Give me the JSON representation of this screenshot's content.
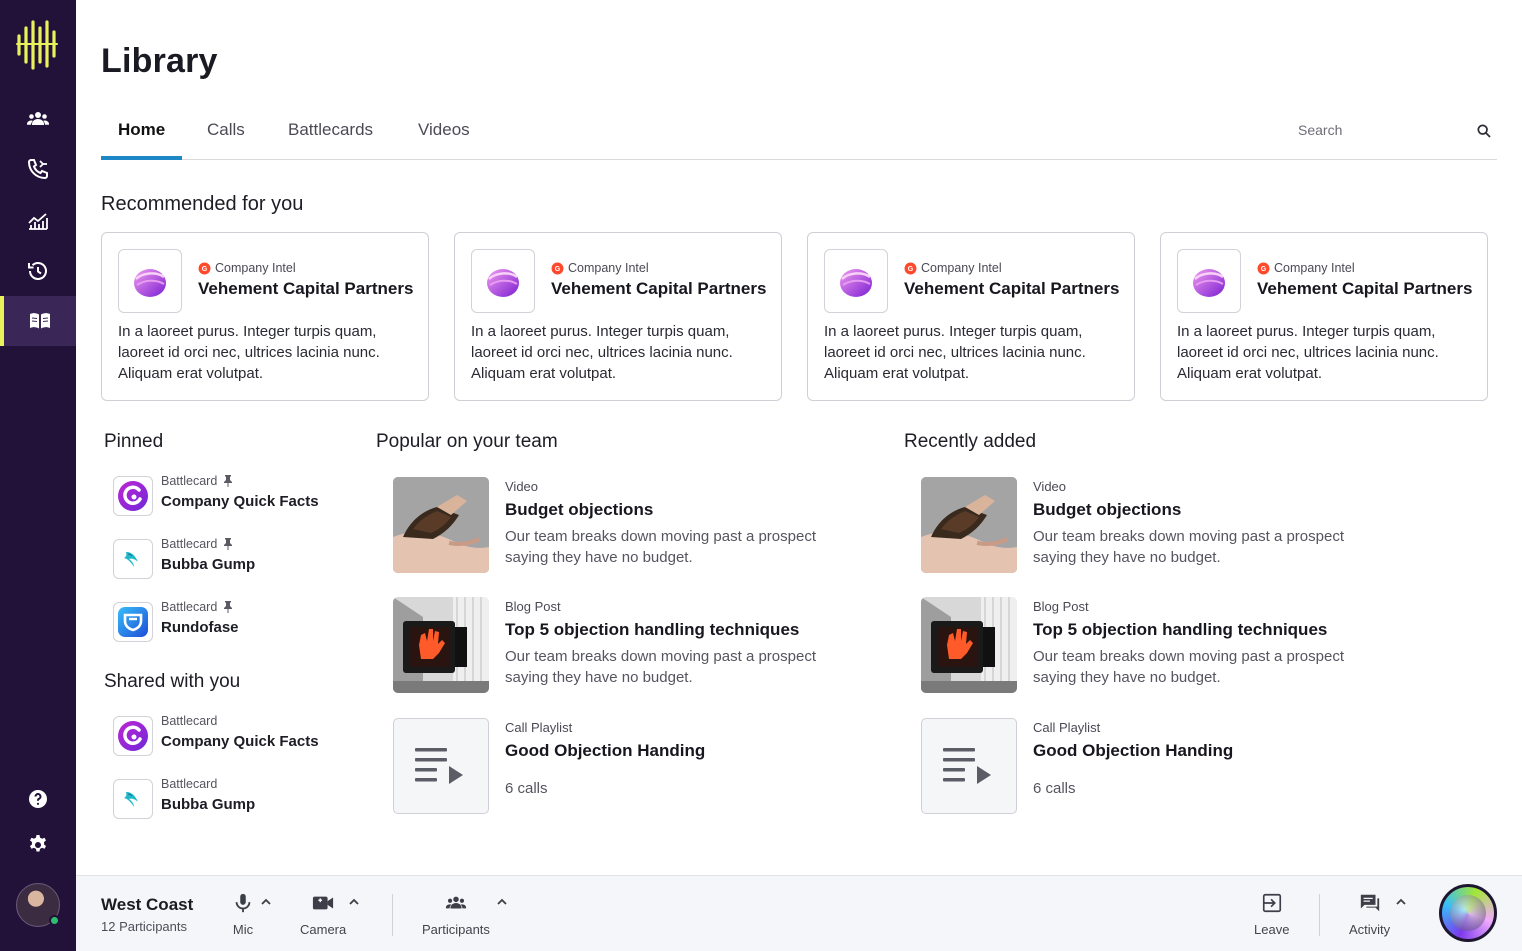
{
  "page": {
    "title": "Library"
  },
  "tabs": [
    {
      "label": "Home",
      "active": true
    },
    {
      "label": "Calls"
    },
    {
      "label": "Battlecards"
    },
    {
      "label": "Videos"
    }
  ],
  "search": {
    "placeholder": "Search"
  },
  "sidebar": {
    "items": [
      {
        "icon": "team-icon"
      },
      {
        "icon": "phone-icon"
      },
      {
        "icon": "analytics-icon"
      },
      {
        "icon": "history-icon"
      },
      {
        "icon": "library-book-icon",
        "active": true
      }
    ],
    "bottom": [
      {
        "icon": "help-icon"
      },
      {
        "icon": "settings-icon"
      }
    ],
    "accent_color": "#eaf25b"
  },
  "recommended": {
    "title": "Recommended for you",
    "cards": [
      {
        "category": "Company Intel",
        "title": "Vehement Capital Partners",
        "description": "In a laoreet purus. Integer turpis quam, laoreet id orci nec, ultrices lacinia nunc. Aliquam erat volutpat."
      },
      {
        "category": "Company Intel",
        "title": "Vehement Capital Partners",
        "description": "In a laoreet purus. Integer turpis quam, laoreet id orci nec, ultrices lacinia nunc. Aliquam erat volutpat."
      },
      {
        "category": "Company Intel",
        "title": "Vehement Capital Partners",
        "description": "In a laoreet purus. Integer turpis quam, laoreet id orci nec, ultrices lacinia nunc. Aliquam erat volutpat."
      },
      {
        "category": "Company Intel",
        "title": "Vehement Capital Partners",
        "description": "In a laoreet purus. Integer turpis quam, laoreet id orci nec, ultrices lacinia nunc. Aliquam erat volutpat."
      }
    ]
  },
  "pinned": {
    "title": "Pinned",
    "items": [
      {
        "type": "Battlecard",
        "name": "Company Quick Facts"
      },
      {
        "type": "Battlecard",
        "name": "Bubba Gump"
      },
      {
        "type": "Battlecard",
        "name": "Rundofase"
      }
    ]
  },
  "shared": {
    "title": "Shared with you",
    "items": [
      {
        "type": "Battlecard",
        "name": "Company Quick Facts"
      },
      {
        "type": "Battlecard",
        "name": "Bubba Gump"
      }
    ]
  },
  "popular": {
    "title": "Popular on your team",
    "items": [
      {
        "type": "Video",
        "title": "Budget objections",
        "description": "Our team breaks down moving past a prospect saying they have no budget."
      },
      {
        "type": "Blog Post",
        "title": "Top 5 objection handling techniques",
        "description": "Our team breaks down moving past a prospect saying they have no budget."
      },
      {
        "type": "Call Playlist",
        "title": "Good Objection Handing",
        "subtitle": "6 calls"
      }
    ]
  },
  "recent": {
    "title": "Recently added",
    "items": [
      {
        "type": "Video",
        "title": "Budget objections",
        "description": "Our team breaks down moving past a prospect saying they have no budget."
      },
      {
        "type": "Blog Post",
        "title": "Top 5 objection handling techniques",
        "description": "Our team breaks down moving past a prospect saying they have no budget."
      },
      {
        "type": "Call Playlist",
        "title": "Good Objection Handing",
        "subtitle": "6 calls"
      }
    ]
  },
  "bottombar": {
    "room_name": "West Coast",
    "participants_count": "12 Participants",
    "mic_label": "Mic",
    "camera_label": "Camera",
    "participants_label": "Participants",
    "leave_label": "Leave",
    "activity_label": "Activity"
  }
}
